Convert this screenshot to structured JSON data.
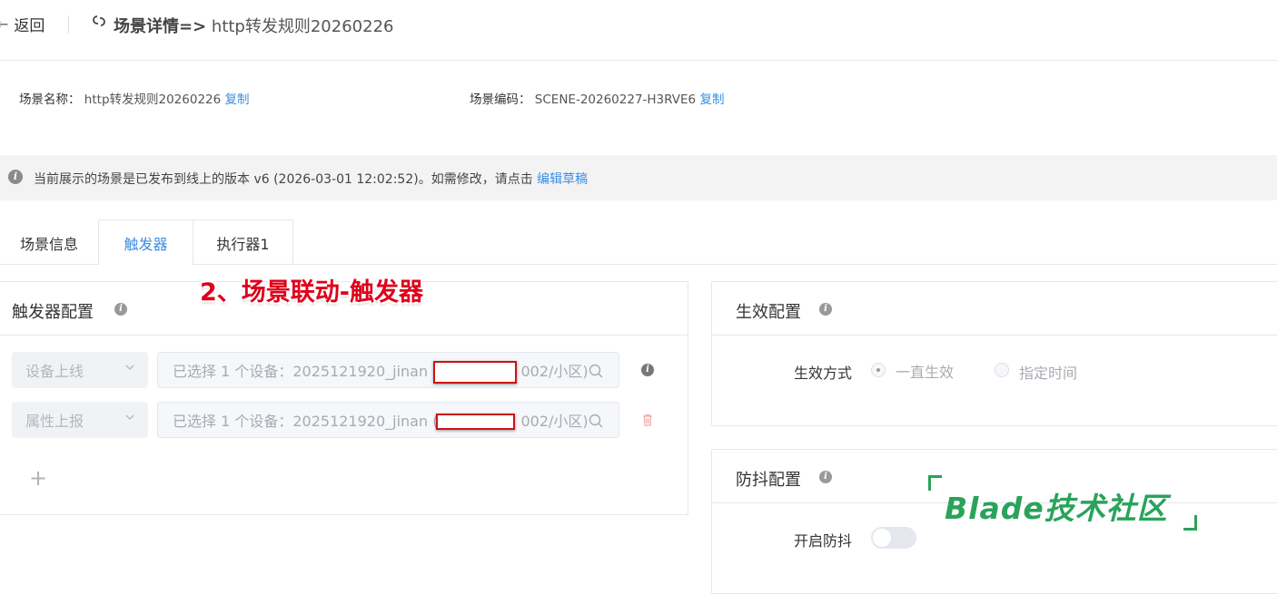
{
  "header": {
    "back_label": "返回",
    "title_bold": "场景详情=>",
    "title_text": "http转发规则20260226"
  },
  "scene_info": {
    "name_label": "场景名称：",
    "name_value": "http转发规则20260226",
    "code_label": "场景编码：",
    "code_value": "SCENE-20260227-H3RVE6",
    "copy_label": "复制"
  },
  "notice": {
    "text": "当前展示的场景是已发布到线上的版本 v6 (2026-03-01 12:02:52)。如需修改，请点击",
    "link": "编辑草稿"
  },
  "tabs": [
    {
      "label": "场景信息",
      "active": false
    },
    {
      "label": "触发器",
      "active": true
    },
    {
      "label": "执行器1",
      "active": false
    }
  ],
  "annotation": "2、场景联动-触发器",
  "trigger_config": {
    "title": "触发器配置",
    "rows": [
      {
        "type": "设备上线",
        "device_prefix": "已选择 1 个设备：2025121920_jinan (",
        "device_suffix": "002/小区)"
      },
      {
        "type": "属性上报",
        "device_prefix": "已选择 1 个设备：2025121920_jinan (",
        "device_suffix": "002/小区)"
      }
    ],
    "add_symbol": "+"
  },
  "effective_config": {
    "title": "生效配置",
    "mode_label": "生效方式",
    "options": [
      {
        "label": "一直生效",
        "selected": true
      },
      {
        "label": "指定时间",
        "selected": false
      }
    ]
  },
  "debounce_config": {
    "title": "防抖配置",
    "toggle_label": "开启防抖",
    "enabled": false
  },
  "watermark": "Blade技术社区",
  "colors": {
    "accent": "#3a8ee6",
    "annotation_red": "#e0001a",
    "watermark_green": "#2aa35a",
    "delete_red": "#f4a7a7"
  }
}
